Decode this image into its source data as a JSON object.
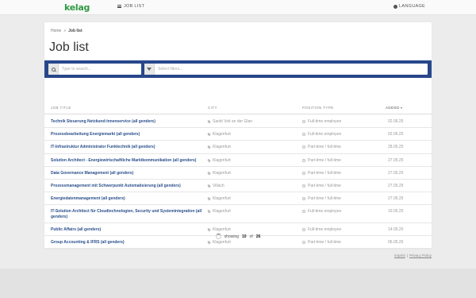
{
  "header": {
    "logo": "kelag",
    "nav_joblist": "JOB LIST",
    "nav_language": "LANGUAGE"
  },
  "breadcrumb": {
    "home": "Home",
    "separator": "»",
    "current": "Job list"
  },
  "page_title": "Job list",
  "filters": {
    "search_placeholder": "Type to search...",
    "filter_placeholder": "Select filters..."
  },
  "table": {
    "headers": {
      "title": "JOB TITLE",
      "city": "CITY",
      "position": "POSITION TYPE",
      "added": "ADDED"
    },
    "rows": [
      {
        "title": "Technik Steuerung Netzkund:innenservice (all genders)",
        "city": "Sankt Veit an der Glan",
        "position": "Full-time employee",
        "date": "02.06.25"
      },
      {
        "title": "Prozessbearbeitung Energiemarkt (all genders)",
        "city": "Klagenfurt",
        "position": "Full-time employee",
        "date": "02.06.25"
      },
      {
        "title": "IT-Infrastruktur Administrator Funktechnik (all genders)",
        "city": "Klagenfurt",
        "position": "Part-time / full-time",
        "date": "28.05.25"
      },
      {
        "title": "Solution Architect - Energiewirtschaftliche Marktkommunikation (all genders)",
        "city": "Klagenfurt",
        "position": "Part-time / full-time",
        "date": "27.05.25"
      },
      {
        "title": "Data Governance Management (all genders)",
        "city": "Klagenfurt",
        "position": "Part-time / full-time",
        "date": "27.05.25"
      },
      {
        "title": "Prozessmanagement mit Schwerpunkt Automatisierung (all genders)",
        "city": "Villach",
        "position": "Part-time / full-time",
        "date": "27.05.25"
      },
      {
        "title": "Energiedatenmanagement (all genders)",
        "city": "Klagenfurt",
        "position": "Part-time / full-time",
        "date": "27.05.25"
      },
      {
        "title": "IT-Solution Architect für Cloudtechnologien, Security und Systemintegration (all genders)",
        "city": "Klagenfurt",
        "position": "Full-time employee",
        "date": "19.05.25"
      },
      {
        "title": "Public Affairs (all genders)",
        "city": "Klagenfurt",
        "position": "Full-time employee",
        "date": "14.05.25"
      },
      {
        "title": "Group Accounting & IFRS (all genders)",
        "city": "Klagenfurt",
        "position": "Part-time / full-time",
        "date": "06.05.25"
      }
    ]
  },
  "pager": {
    "prefix": "showing",
    "shown": "10",
    "of_label": "of",
    "total": "26"
  },
  "footer": {
    "imprint": "Imprint",
    "separator": "|",
    "privacy": "Privacy Policy"
  },
  "colors": {
    "brand_green": "#2e9a44",
    "filter_bar": "#28478a",
    "link_blue": "#2a4f8c"
  }
}
